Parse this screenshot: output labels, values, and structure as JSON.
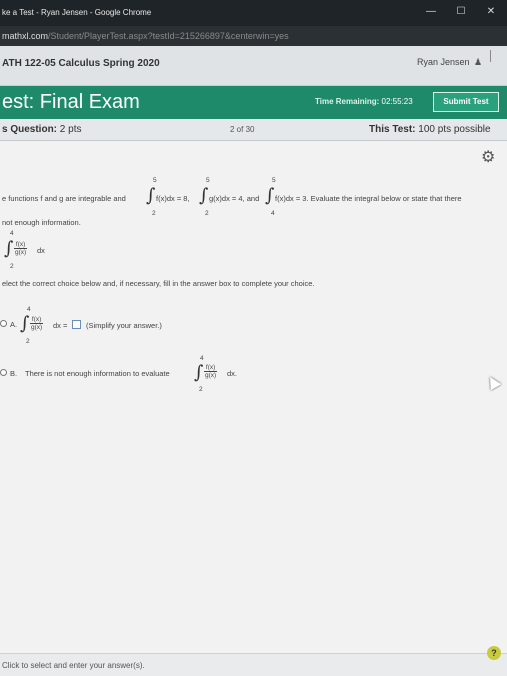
{
  "browser": {
    "window_title": "ke a Test - Ryan Jensen - Google Chrome",
    "url_host": "mathxl.com",
    "url_path": "/Student/PlayerTest.aspx?testId=215266897&centerwin=yes",
    "minimize": "—",
    "maximize": "☐",
    "close": "✕"
  },
  "course": {
    "title": "ATH 122-05 Calculus Spring 2020",
    "user_name": "Ryan Jensen",
    "user_icon": "user-icon"
  },
  "test": {
    "title": "est: Final Exam",
    "time_label": "Time Remaining:",
    "time_value": "02:55:23",
    "submit_label": "Submit Test"
  },
  "question_bar": {
    "label": "s Question:",
    "points": "2 pts",
    "position": "2 of 30",
    "total_label": "This Test:",
    "total_value": "100 pts possible"
  },
  "question": {
    "intro": "e functions f and g are integrable and",
    "int1": {
      "upper": "5",
      "lower": "2",
      "body": "f(x)dx = 8,"
    },
    "int2": {
      "upper": "5",
      "lower": "2",
      "body": "g(x)dx = 4, and"
    },
    "int3": {
      "upper": "5",
      "lower": "4",
      "body": "f(x)dx = 3. Evaluate the integral below or state that there"
    },
    "intro_line2": "not enough information.",
    "target": {
      "upper": "4",
      "lower": "2",
      "num": "f(x)",
      "den": "g(x)",
      "dx": "dx"
    },
    "instruction": "elect the correct choice below and, if necessary, fill in the answer box to complete your choice."
  },
  "choices": {
    "a": {
      "letter": "A.",
      "upper": "4",
      "lower": "2",
      "num": "f(x)",
      "den": "g(x)",
      "dx_eq": "dx =",
      "hint": "(Simplify your answer.)"
    },
    "b": {
      "letter": "B.",
      "text": "There is not enough information to evaluate",
      "upper": "4",
      "lower": "2",
      "num": "f(x)",
      "den": "g(x)",
      "dx": "dx."
    }
  },
  "footer": {
    "text": "Click to select and enter your answer(s).",
    "help": "?"
  },
  "colors": {
    "test_header": "#1f8a6a",
    "submit_button": "#2aa17c",
    "help_button": "#c7cc3e"
  }
}
